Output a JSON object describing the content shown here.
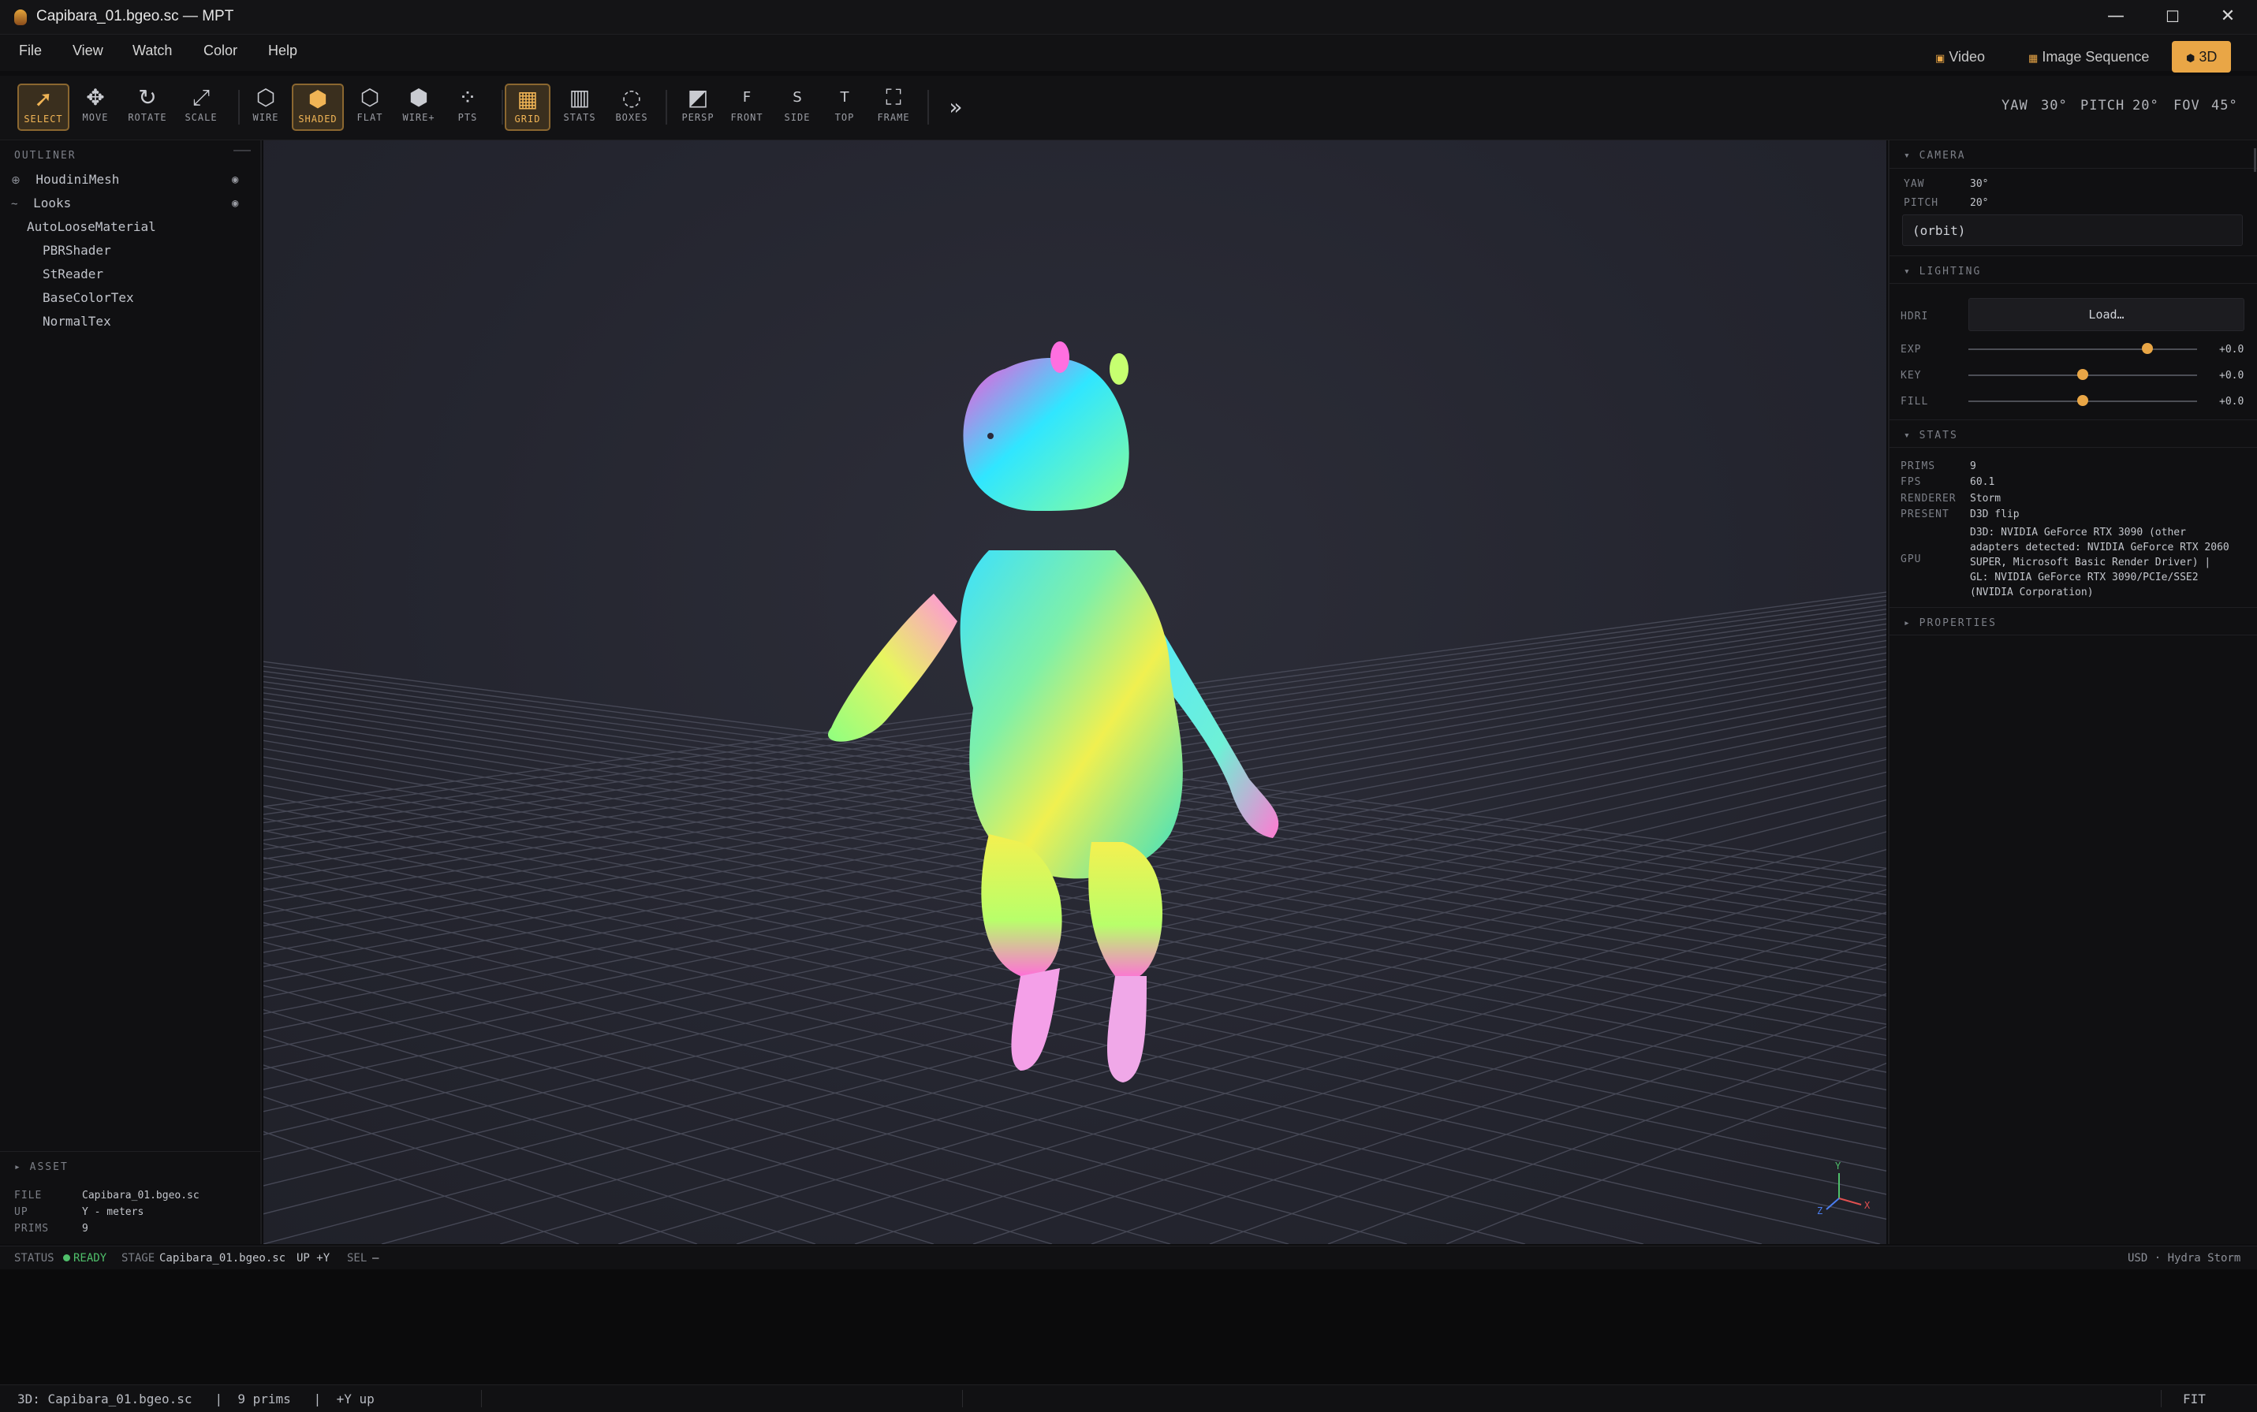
{
  "window": {
    "title": "Capibara_01.bgeo.sc — MPT",
    "controls": {
      "minimize": "—",
      "maximize": "☐",
      "close": "✕"
    }
  },
  "menu": [
    "File",
    "View",
    "Watch",
    "Color",
    "Help"
  ],
  "modes": [
    {
      "label": "Video",
      "icon": "video-icon",
      "glyph": "▣"
    },
    {
      "label": "Image Sequence",
      "icon": "image-icon",
      "glyph": "▦"
    },
    {
      "label": "3D",
      "icon": "cube-icon",
      "glyph": "⬢",
      "active": true
    }
  ],
  "toolbar": {
    "transform": [
      {
        "label": "SELECT",
        "glyph": "➚",
        "icon": "cursor-icon",
        "active": true
      },
      {
        "label": "MOVE",
        "glyph": "✥",
        "icon": "move-icon"
      },
      {
        "label": "ROTATE",
        "glyph": "↻",
        "icon": "rotate-icon"
      },
      {
        "label": "SCALE",
        "glyph": "⤢",
        "icon": "scale-icon"
      }
    ],
    "shading": [
      {
        "label": "WIRE",
        "glyph": "⬡",
        "icon": "wireframe-cube-icon"
      },
      {
        "label": "SHADED",
        "glyph": "⬢",
        "icon": "shaded-cube-icon",
        "active": true
      },
      {
        "label": "FLAT",
        "glyph": "⬡",
        "icon": "flat-hex-icon"
      },
      {
        "label": "WIRE+",
        "glyph": "⬢",
        "icon": "wire-plus-icon"
      },
      {
        "label": "PTS",
        "glyph": "⁘",
        "icon": "points-icon"
      }
    ],
    "overlays": [
      {
        "label": "GRID",
        "glyph": "▦",
        "icon": "grid-icon",
        "active": true
      },
      {
        "label": "STATS",
        "glyph": "▥",
        "icon": "stats-icon"
      },
      {
        "label": "BOXES",
        "glyph": "◌",
        "icon": "bounding-box-icon"
      }
    ],
    "views": [
      {
        "label": "PERSP",
        "glyph": "◩",
        "icon": "perspective-icon"
      },
      {
        "label": "FRONT",
        "glyph": "F",
        "icon": "front-view-icon"
      },
      {
        "label": "SIDE",
        "glyph": "S",
        "icon": "side-view-icon"
      },
      {
        "label": "TOP",
        "glyph": "T",
        "icon": "top-view-icon"
      },
      {
        "label": "FRAME",
        "glyph": "⛶",
        "icon": "frame-icon"
      }
    ],
    "more": "»",
    "readout": {
      "yaw_label": "YAW",
      "yaw": "30°",
      "pitch_label": "PITCH",
      "pitch": "20°",
      "fov_label": "FOV",
      "fov": "45°"
    }
  },
  "outliner": {
    "title": "OUTLINER",
    "items": [
      {
        "label": "HoudiniMesh",
        "indent": 0,
        "icon": "mesh-icon",
        "glyph": "⊕",
        "eye": true
      },
      {
        "label": "Looks",
        "indent": 0,
        "icon": "material-icon",
        "glyph": "~",
        "eye": true
      },
      {
        "label": "AutoLooseMaterial",
        "indent": 1
      },
      {
        "label": "PBRShader",
        "indent": 2
      },
      {
        "label": "StReader",
        "indent": 2
      },
      {
        "label": "BaseColorTex",
        "indent": 2
      },
      {
        "label": "NormalTex",
        "indent": 2
      }
    ]
  },
  "asset": {
    "title": "ASSET",
    "rows": [
      {
        "k": "FILE",
        "v": "Capibara_01.bgeo.sc"
      },
      {
        "k": "UP",
        "v": "Y - meters"
      },
      {
        "k": "PRIMS",
        "v": "9"
      }
    ]
  },
  "camera": {
    "title": "CAMERA",
    "yaw_label": "YAW",
    "yaw": "30°",
    "pitch_label": "PITCH",
    "pitch": "20°",
    "mode": "(orbit)"
  },
  "lighting": {
    "title": "LIGHTING",
    "hdri_label": "HDRI",
    "load_label": "Load…",
    "sliders": [
      {
        "label": "EXP",
        "value": "+0.0",
        "position": 0.78
      },
      {
        "label": "KEY",
        "value": "+0.0",
        "position": 0.5
      },
      {
        "label": "FILL",
        "value": "+0.0",
        "position": 0.5
      }
    ]
  },
  "stats": {
    "title": "STATS",
    "prims_label": "PRIMS",
    "prims": "9",
    "fps_label": "FPS",
    "fps": "60.1",
    "renderer_label": "RENDERER",
    "renderer": "Storm",
    "present_label": "PRESENT",
    "present": "D3D flip",
    "gpu_label": "GPU",
    "gpu_lines": [
      "D3D: NVIDIA GeForce RTX 3090 (other",
      "adapters detected: NVIDIA GeForce RTX 2060",
      "SUPER, Microsoft Basic Render Driver)  |",
      "GL: NVIDIA GeForce RTX 3090/PCIe/SSE2",
      "(NVIDIA Corporation)"
    ]
  },
  "properties": {
    "title": "PROPERTIES"
  },
  "axis_gizmo": {
    "y": "Y",
    "x": "X",
    "z": "Z"
  },
  "status": {
    "status_label": "STATUS",
    "status": "READY",
    "stage_label": "STAGE",
    "stage": "Capibara_01.bgeo.sc",
    "up": "UP +Y",
    "sel_label": "SEL",
    "sel": "—",
    "right": "USD · Hydra Storm"
  },
  "footer": {
    "left": "3D: Capibara_01.bgeo.sc   |  9 prims   |  +Y up",
    "right": "FIT"
  },
  "colors": {
    "accent": "#e9a646",
    "ready": "#4fbf6a"
  }
}
